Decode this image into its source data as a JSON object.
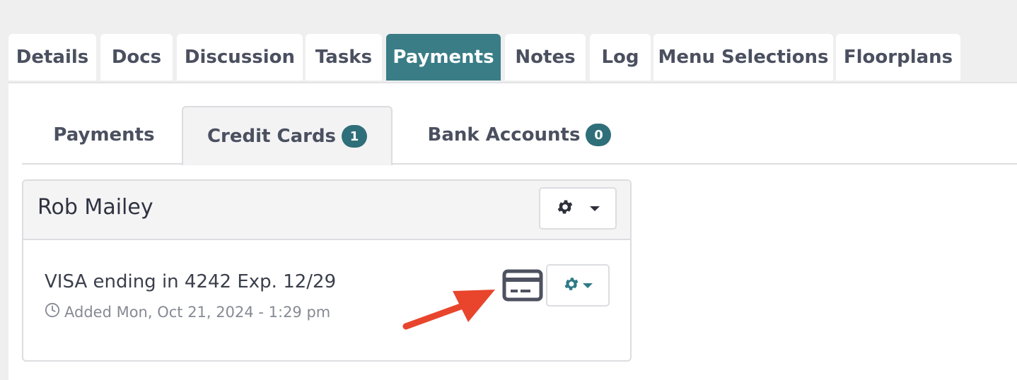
{
  "main_tabs": [
    {
      "label": "Details",
      "active": false
    },
    {
      "label": "Docs",
      "active": false
    },
    {
      "label": "Discussion",
      "active": false
    },
    {
      "label": "Tasks",
      "active": false
    },
    {
      "label": "Payments",
      "active": true
    },
    {
      "label": "Notes",
      "active": false
    },
    {
      "label": "Log",
      "active": false
    },
    {
      "label": "Menu Selections",
      "active": false
    },
    {
      "label": "Floorplans",
      "active": false
    }
  ],
  "sub_tabs": {
    "payments": {
      "label": "Payments"
    },
    "credit_cards": {
      "label": "Credit Cards",
      "count": "1",
      "active": true
    },
    "bank_accounts": {
      "label": "Bank Accounts",
      "count": "0"
    }
  },
  "card": {
    "title": "Rob Mailey",
    "item": {
      "description": "VISA ending in 4242 Exp. 12/29",
      "added": "Added Mon, Oct 21, 2024 - 1:29 pm"
    }
  },
  "icons": {
    "header_settings": "gear-icon",
    "item_settings": "gear-icon",
    "credit_card": "credit-card-icon",
    "clock": "clock-icon",
    "annotation": "red-arrow"
  },
  "colors": {
    "accent": "#3a7d86",
    "badge": "#2f6f79",
    "arrow": "#e8452c",
    "gear_teal": "#2f7a86"
  }
}
